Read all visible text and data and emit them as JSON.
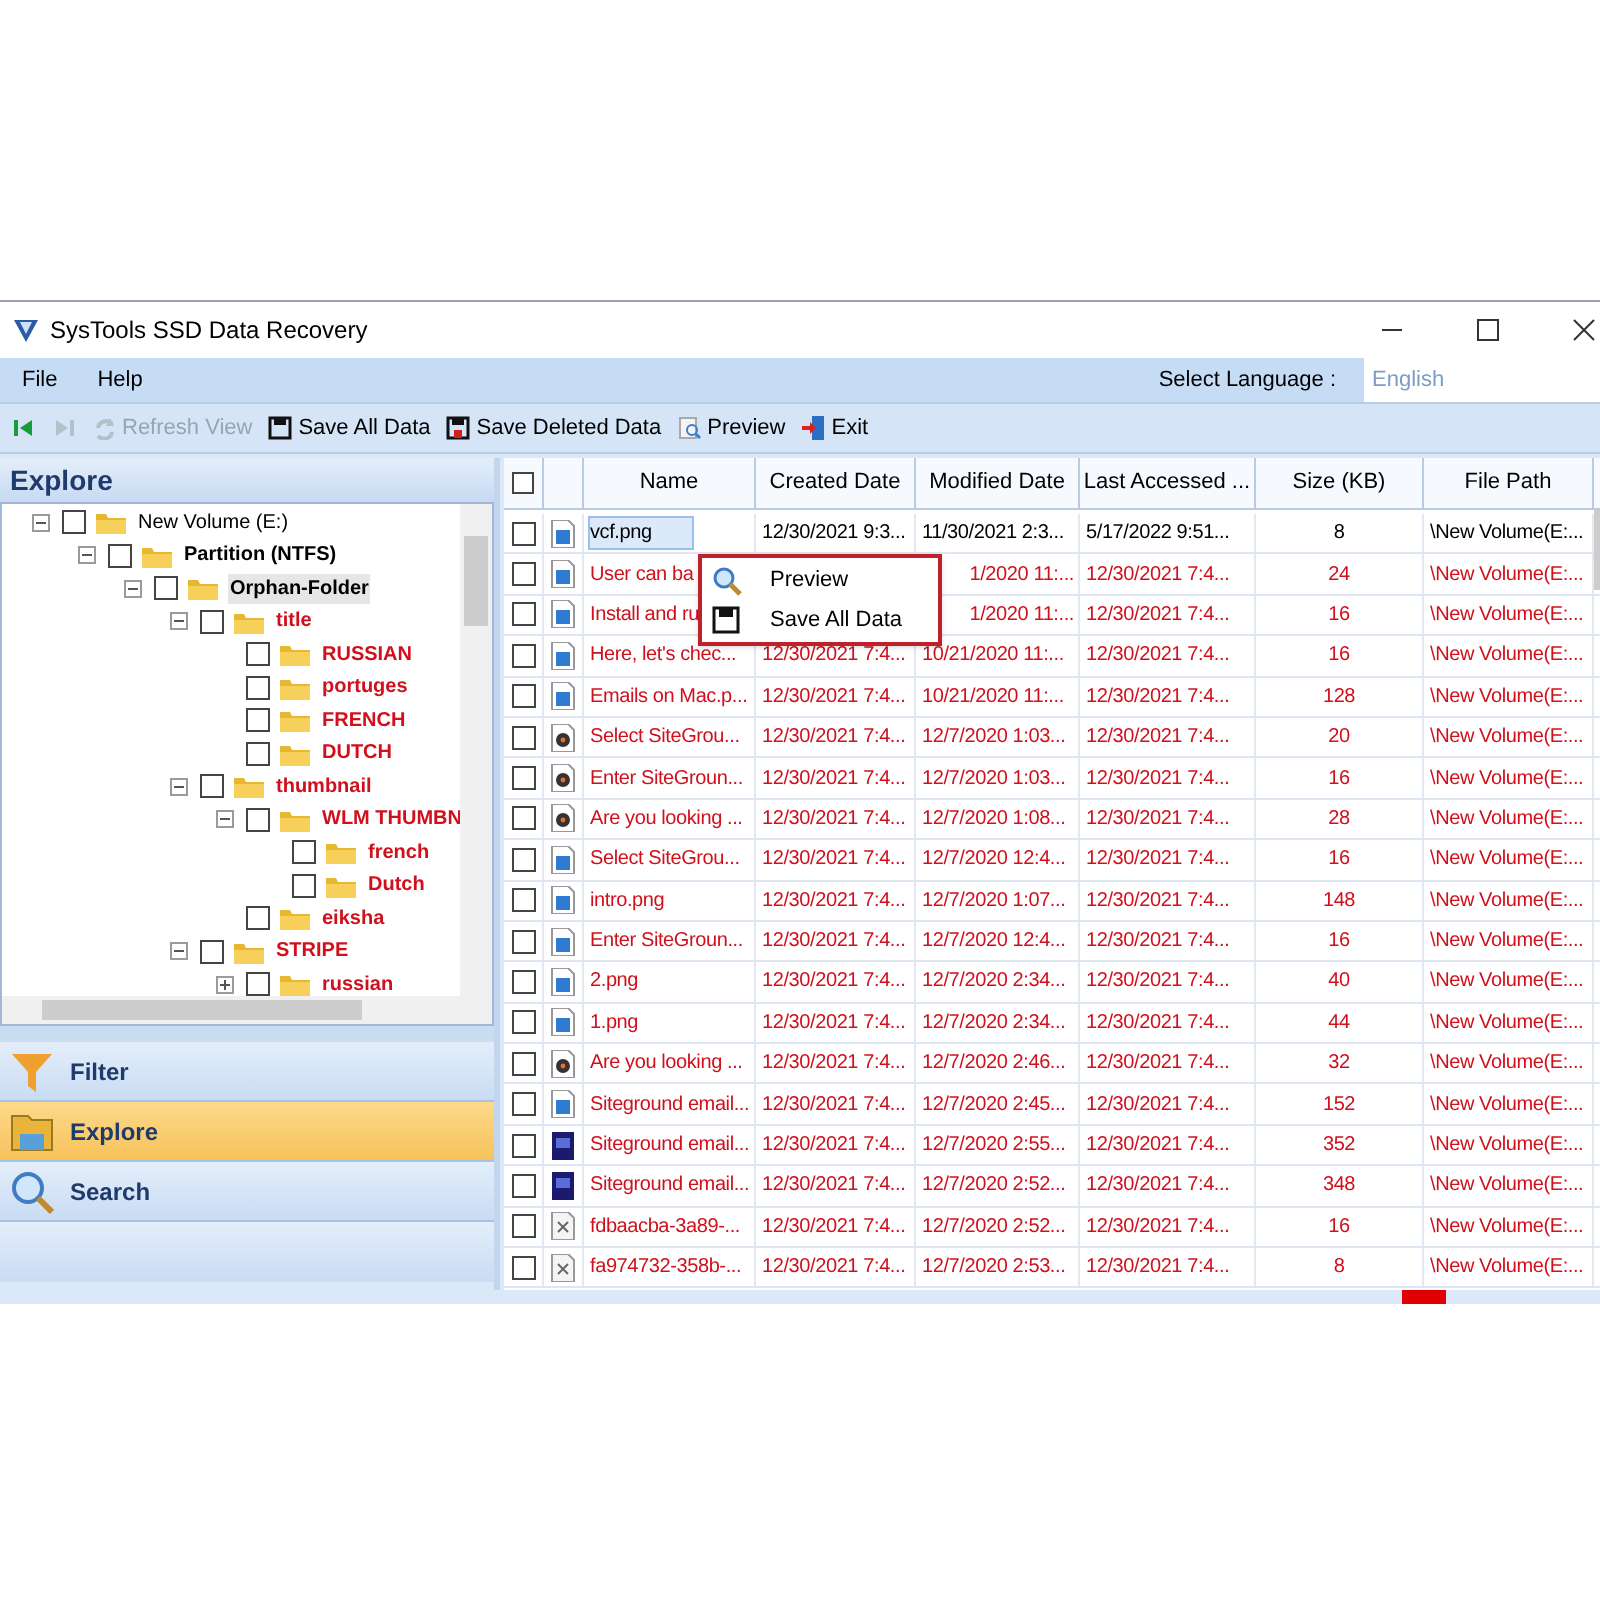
{
  "window": {
    "title": "SysTools SSD Data Recovery"
  },
  "menu": [
    "File",
    "Help"
  ],
  "language": {
    "label": "Select Language :",
    "value": "English"
  },
  "toolbar": [
    {
      "kind": "first",
      "disabled": false
    },
    {
      "kind": "last",
      "disabled": true
    },
    {
      "kind": "refresh",
      "label": "Refresh View",
      "disabled": true
    },
    {
      "kind": "save",
      "label": "Save All Data",
      "disabled": false
    },
    {
      "kind": "save-deleted",
      "label": "Save Deleted Data",
      "disabled": false
    },
    {
      "kind": "preview",
      "label": "Preview",
      "disabled": false
    },
    {
      "kind": "exit",
      "label": "Exit",
      "disabled": false
    }
  ],
  "explore_title": "Explore",
  "tree": [
    {
      "label": "New Volume (E:)",
      "expanded": true,
      "checked": false,
      "deleted": false,
      "bold": false,
      "selected": false,
      "children": [
        {
          "label": "Partition (NTFS)",
          "expanded": true,
          "checked": false,
          "deleted": false,
          "bold": true,
          "selected": false,
          "children": [
            {
              "label": "Orphan-Folder",
              "expanded": true,
              "checked": false,
              "deleted": false,
              "bold": true,
              "selected": true,
              "children": [
                {
                  "label": "title",
                  "expanded": true,
                  "checked": false,
                  "deleted": true,
                  "bold": true,
                  "selected": false,
                  "children": [
                    {
                      "label": "RUSSIAN",
                      "checked": false,
                      "deleted": true,
                      "bold": true,
                      "selected": false
                    },
                    {
                      "label": "portuges",
                      "checked": false,
                      "deleted": true,
                      "bold": true,
                      "selected": false
                    },
                    {
                      "label": "FRENCH",
                      "checked": false,
                      "deleted": true,
                      "bold": true,
                      "selected": false
                    },
                    {
                      "label": "DUTCH",
                      "checked": false,
                      "deleted": true,
                      "bold": true,
                      "selected": false
                    }
                  ]
                },
                {
                  "label": "thumbnail",
                  "expanded": true,
                  "checked": false,
                  "deleted": true,
                  "bold": true,
                  "selected": false,
                  "children": [
                    {
                      "label": "WLM THUMBN",
                      "expanded": true,
                      "checked": false,
                      "deleted": true,
                      "bold": true,
                      "selected": false,
                      "children": [
                        {
                          "label": "french",
                          "checked": false,
                          "deleted": true,
                          "bold": true,
                          "selected": false
                        },
                        {
                          "label": "Dutch",
                          "checked": false,
                          "deleted": true,
                          "bold": true,
                          "selected": false
                        }
                      ]
                    },
                    {
                      "label": "eiksha",
                      "checked": false,
                      "deleted": true,
                      "bold": true,
                      "selected": false
                    }
                  ]
                },
                {
                  "label": "STRIPE",
                  "expanded": true,
                  "checked": false,
                  "deleted": true,
                  "bold": true,
                  "selected": false,
                  "children": [
                    {
                      "label": "russian",
                      "expanded": false,
                      "checked": false,
                      "deleted": true,
                      "bold": true,
                      "selected": false
                    }
                  ]
                }
              ]
            }
          ]
        }
      ]
    }
  ],
  "nav": [
    {
      "kind": "filter",
      "label": "Filter",
      "selected": false
    },
    {
      "kind": "explore",
      "label": "Explore",
      "selected": true
    },
    {
      "kind": "search",
      "label": "Search",
      "selected": false
    }
  ],
  "table": {
    "all_checked": false,
    "columns": [
      "Name",
      "Created Date",
      "Modified Date",
      "Last Accessed ...",
      "Size (KB)",
      "File Path"
    ],
    "rows": [
      {
        "kind": "image",
        "name": "vcf.png",
        "created": "12/30/2021 9:3...",
        "modified": "11/30/2021 2:3...",
        "accessed": "5/17/2022 9:51...",
        "size": "8",
        "path": "\\New Volume(E:...",
        "checked": false,
        "deleted": false,
        "selected": true
      },
      {
        "kind": "image",
        "name": "User can ba",
        "modified": "1/2020 11:...",
        "accessed": "12/30/2021 7:4...",
        "size": "24",
        "path": "\\New Volume(E:...",
        "checked": false,
        "deleted": true,
        "selected": false
      },
      {
        "kind": "image",
        "name": "Install and ru",
        "modified": "1/2020 11:...",
        "accessed": "12/30/2021 7:4...",
        "size": "16",
        "path": "\\New Volume(E:...",
        "checked": false,
        "deleted": true,
        "selected": false
      },
      {
        "kind": "image",
        "name": "Here, let's chec...",
        "created": "12/30/2021 7:4...",
        "modified": "10/21/2020 11:...",
        "accessed": "12/30/2021 7:4...",
        "size": "16",
        "path": "\\New Volume(E:...",
        "checked": false,
        "deleted": true,
        "selected": false
      },
      {
        "kind": "image",
        "name": "Emails on Mac.p...",
        "created": "12/30/2021 7:4...",
        "modified": "10/21/2020 11:...",
        "accessed": "12/30/2021 7:4...",
        "size": "128",
        "path": "\\New Volume(E:...",
        "checked": false,
        "deleted": true,
        "selected": false
      },
      {
        "kind": "disc",
        "name": "Select SiteGrou...",
        "created": "12/30/2021 7:4...",
        "modified": "12/7/2020 1:03...",
        "accessed": "12/30/2021 7:4...",
        "size": "20",
        "path": "\\New Volume(E:...",
        "checked": false,
        "deleted": true,
        "selected": false
      },
      {
        "kind": "disc",
        "name": "Enter SiteGroun...",
        "created": "12/30/2021 7:4...",
        "modified": "12/7/2020 1:03...",
        "accessed": "12/30/2021 7:4...",
        "size": "16",
        "path": "\\New Volume(E:...",
        "checked": false,
        "deleted": true,
        "selected": false
      },
      {
        "kind": "disc",
        "name": "Are you looking ...",
        "created": "12/30/2021 7:4...",
        "modified": "12/7/2020 1:08...",
        "accessed": "12/30/2021 7:4...",
        "size": "28",
        "path": "\\New Volume(E:...",
        "checked": false,
        "deleted": true,
        "selected": false
      },
      {
        "kind": "image",
        "name": "Select SiteGrou...",
        "created": "12/30/2021 7:4...",
        "modified": "12/7/2020 12:4...",
        "accessed": "12/30/2021 7:4...",
        "size": "16",
        "path": "\\New Volume(E:...",
        "checked": false,
        "deleted": true,
        "selected": false
      },
      {
        "kind": "image",
        "name": "intro.png",
        "created": "12/30/2021 7:4...",
        "modified": "12/7/2020 1:07...",
        "accessed": "12/30/2021 7:4...",
        "size": "148",
        "path": "\\New Volume(E:...",
        "checked": false,
        "deleted": true,
        "selected": false
      },
      {
        "kind": "image",
        "name": "Enter SiteGroun...",
        "created": "12/30/2021 7:4...",
        "modified": "12/7/2020 12:4...",
        "accessed": "12/30/2021 7:4...",
        "size": "16",
        "path": "\\New Volume(E:...",
        "checked": false,
        "deleted": true,
        "selected": false
      },
      {
        "kind": "image",
        "name": "2.png",
        "created": "12/30/2021 7:4...",
        "modified": "12/7/2020 2:34...",
        "accessed": "12/30/2021 7:4...",
        "size": "40",
        "path": "\\New Volume(E:...",
        "checked": false,
        "deleted": true,
        "selected": false
      },
      {
        "kind": "image",
        "name": "1.png",
        "created": "12/30/2021 7:4...",
        "modified": "12/7/2020 2:34...",
        "accessed": "12/30/2021 7:4...",
        "size": "44",
        "path": "\\New Volume(E:...",
        "checked": false,
        "deleted": true,
        "selected": false
      },
      {
        "kind": "disc",
        "name": "Are you looking ...",
        "created": "12/30/2021 7:4...",
        "modified": "12/7/2020 2:46...",
        "accessed": "12/30/2021 7:4...",
        "size": "32",
        "path": "\\New Volume(E:...",
        "checked": false,
        "deleted": true,
        "selected": false
      },
      {
        "kind": "image",
        "name": "Siteground email...",
        "created": "12/30/2021 7:4...",
        "modified": "12/7/2020 2:45...",
        "accessed": "12/30/2021 7:4...",
        "size": "152",
        "path": "\\New Volume(E:...",
        "checked": false,
        "deleted": true,
        "selected": false
      },
      {
        "kind": "premiere",
        "name": "Siteground email...",
        "created": "12/30/2021 7:4...",
        "modified": "12/7/2020 2:55...",
        "accessed": "12/30/2021 7:4...",
        "size": "352",
        "path": "\\New Volume(E:...",
        "checked": false,
        "deleted": true,
        "selected": false
      },
      {
        "kind": "premiere",
        "name": "Siteground email...",
        "created": "12/30/2021 7:4...",
        "modified": "12/7/2020 2:52...",
        "accessed": "12/30/2021 7:4...",
        "size": "348",
        "path": "\\New Volume(E:...",
        "checked": false,
        "deleted": true,
        "selected": false
      },
      {
        "kind": "generic",
        "name": "fdbaacba-3a89-...",
        "created": "12/30/2021 7:4...",
        "modified": "12/7/2020 2:52...",
        "accessed": "12/30/2021 7:4...",
        "size": "16",
        "path": "\\New Volume(E:...",
        "checked": false,
        "deleted": true,
        "selected": false
      },
      {
        "kind": "generic",
        "name": "fa974732-358b-...",
        "created": "12/30/2021 7:4...",
        "modified": "12/7/2020 2:53...",
        "accessed": "12/30/2021 7:4...",
        "size": "8",
        "path": "\\New Volume(E:...",
        "checked": false,
        "deleted": true,
        "selected": false
      }
    ]
  },
  "context_menu": [
    {
      "kind": "preview",
      "label": "Preview"
    },
    {
      "kind": "save",
      "label": "Save All Data"
    }
  ]
}
